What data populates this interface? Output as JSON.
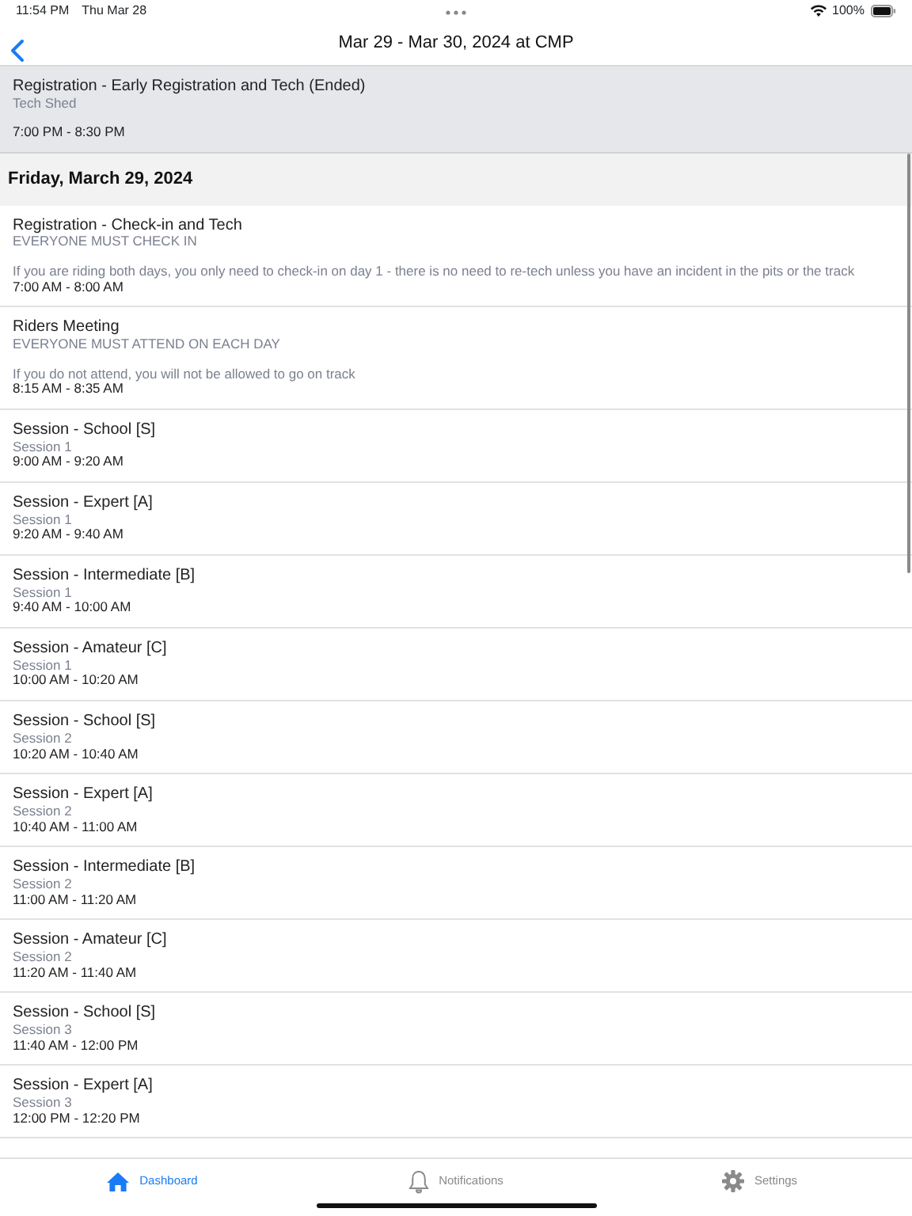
{
  "status_bar": {
    "time": "11:54 PM",
    "date": "Thu Mar 28",
    "battery": "100%"
  },
  "nav": {
    "title": "Mar 29 - Mar 30, 2024 at CMP"
  },
  "past_event": {
    "title": "Registration - Early Registration and Tech (Ended)",
    "subtitle": "Tech Shed",
    "time": "7:00 PM - 8:30 PM",
    "ended": true
  },
  "sections": [
    {
      "heading": "Friday, March 29, 2024",
      "events": [
        {
          "title": "Registration - Check-in and Tech",
          "subtitle": "EVERYONE MUST CHECK IN",
          "note": "If you are riding both days, you only need to check-in on day 1 - there is no need to re-tech unless you have an incident in the pits or the track",
          "time": "7:00 AM - 8:00 AM"
        },
        {
          "title": "Riders Meeting",
          "subtitle": "EVERYONE MUST ATTEND ON EACH DAY",
          "note": "If you do not attend, you will not be allowed to go on track",
          "time": "8:15 AM - 8:35 AM"
        },
        {
          "title": "Session - School [S]",
          "subtitle": "Session 1",
          "time": "9:00 AM - 9:20 AM"
        },
        {
          "title": "Session - Expert [A]",
          "subtitle": "Session 1",
          "time": "9:20 AM - 9:40 AM"
        },
        {
          "title": "Session - Intermediate [B]",
          "subtitle": "Session 1",
          "time": "9:40 AM - 10:00 AM"
        },
        {
          "title": "Session - Amateur [C]",
          "subtitle": "Session 1",
          "time": "10:00 AM - 10:20 AM"
        },
        {
          "title": "Session - School [S]",
          "subtitle": "Session 2",
          "time": "10:20 AM - 10:40 AM"
        },
        {
          "title": "Session - Expert [A]",
          "subtitle": "Session 2",
          "time": "10:40 AM - 11:00 AM"
        },
        {
          "title": "Session - Intermediate [B]",
          "subtitle": "Session 2",
          "time": "11:00 AM - 11:20 AM"
        },
        {
          "title": "Session - Amateur [C]",
          "subtitle": "Session 2",
          "time": "11:20 AM - 11:40 AM"
        },
        {
          "title": "Session - School [S]",
          "subtitle": "Session 3",
          "time": "11:40 AM - 12:00 PM"
        },
        {
          "title": "Session - Expert [A]",
          "subtitle": "Session 3",
          "time": "12:00 PM - 12:20 PM"
        }
      ]
    }
  ],
  "tabs": [
    {
      "label": "Dashboard",
      "kind": "home",
      "selected": true
    },
    {
      "label": "Notifications",
      "kind": "bell",
      "selected": false
    },
    {
      "label": "Settings",
      "kind": "gear",
      "selected": false
    }
  ]
}
